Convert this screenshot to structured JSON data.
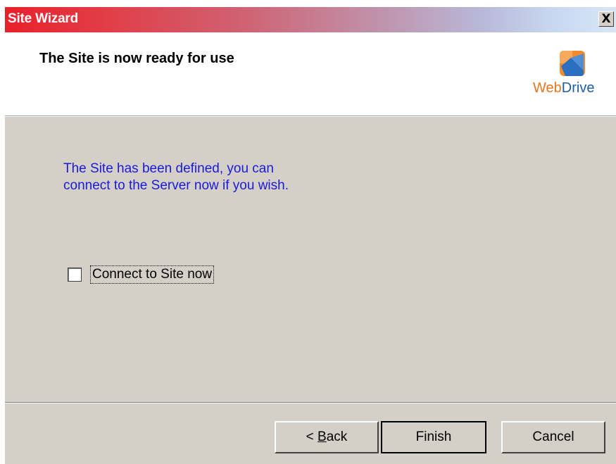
{
  "window": {
    "title": "Site Wizard",
    "close_glyph": "X"
  },
  "header": {
    "title": "The Site is now ready for use",
    "logo": {
      "text_web": "Web",
      "text_drive": "Drive",
      "icon": "webdrive-logo-icon"
    }
  },
  "body": {
    "message_line1": "The Site has been defined, you can",
    "message_line2": "connect to the Server now if you wish.",
    "checkbox": {
      "label": "Connect to Site now",
      "checked": false
    }
  },
  "footer": {
    "back_prefix": "< ",
    "back_accel": "B",
    "back_rest": "ack",
    "finish_label": "Finish",
    "cancel_label": "Cancel"
  },
  "colors": {
    "message_text": "#1a1ad8",
    "dialog_bg": "#d4d0c8",
    "title_gradient_start": "#e8202a",
    "logo_orange": "#e8741e",
    "logo_blue": "#1e5ca8"
  }
}
